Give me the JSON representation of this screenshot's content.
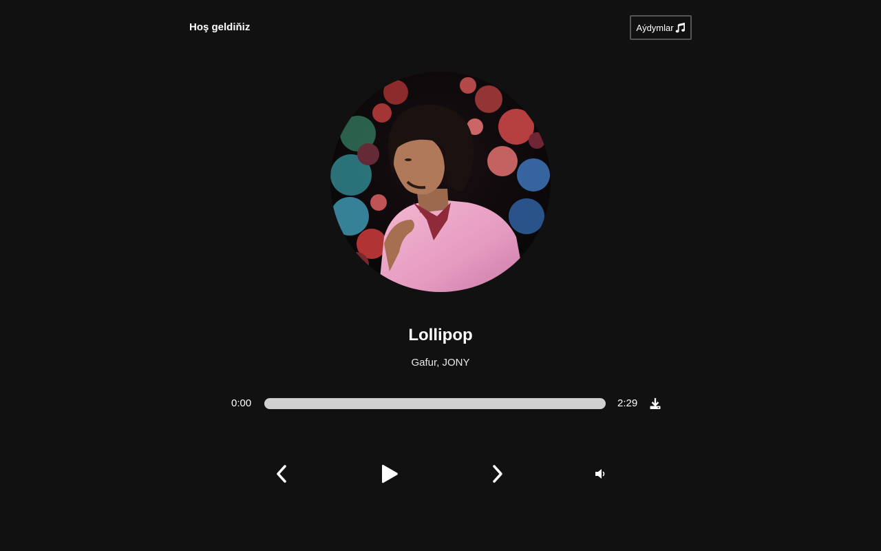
{
  "header": {
    "title": "Hoş geldiňiz",
    "songs_button_label": "Aýdymlar",
    "songs_button_icon": "music-note-icon"
  },
  "player": {
    "cover_description": "album-cover",
    "title": "Lollipop",
    "artist": "Gafur, JONY",
    "current_time": "0:00",
    "total_time": "2:29",
    "progress_fraction": 0,
    "controls": {
      "download_icon": "download-icon",
      "previous_icon": "chevron-left-icon",
      "play_icon": "play-icon",
      "next_icon": "chevron-right-icon",
      "volume_icon": "volume-icon"
    }
  },
  "colors": {
    "background": "#111111",
    "text": "#ffffff",
    "progress_track": "#d0d0d0",
    "button_border": "#555555"
  }
}
